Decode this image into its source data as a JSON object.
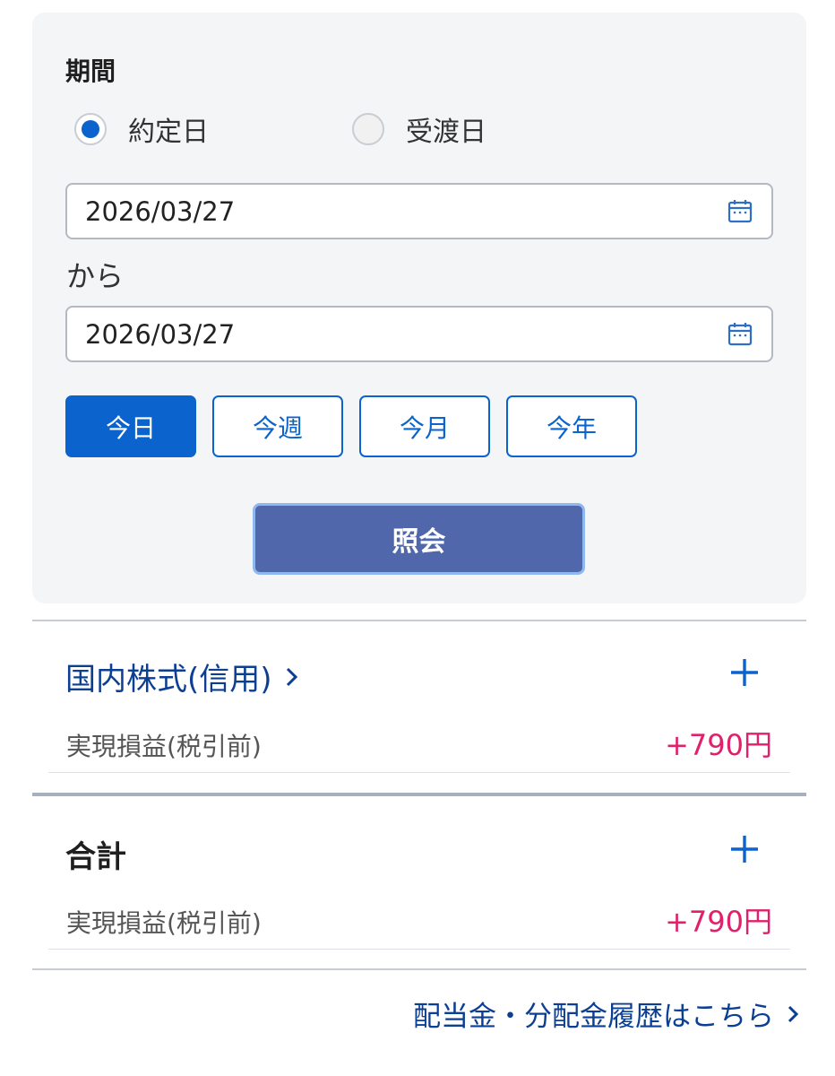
{
  "filter": {
    "period_label": "期間",
    "radios": [
      {
        "label": "約定日",
        "selected": true
      },
      {
        "label": "受渡日",
        "selected": false
      }
    ],
    "date_from": "2026/03/27",
    "between_label": "から",
    "date_to": "2026/03/27",
    "chips": [
      {
        "label": "今日",
        "active": true
      },
      {
        "label": "今週",
        "active": false
      },
      {
        "label": "今月",
        "active": false
      },
      {
        "label": "今年",
        "active": false
      }
    ],
    "query_button": "照会"
  },
  "sections": [
    {
      "title": "国内株式(信用)",
      "row_label": "実現損益(税引前)",
      "row_value": "+790円"
    },
    {
      "title": "合計",
      "row_label": "実現損益(税引前)",
      "row_value": "+790円"
    }
  ],
  "footer_link": "配当金・分配金履歴はこちら",
  "icons": {
    "calendar": "calendar-icon",
    "plus": "plus-icon",
    "chevron": "chevron-right-icon"
  },
  "colors": {
    "accent": "#0b63ce",
    "navy_text": "#0b3f93",
    "query_button": "#5068ab",
    "positive_value": "#e0206b"
  }
}
